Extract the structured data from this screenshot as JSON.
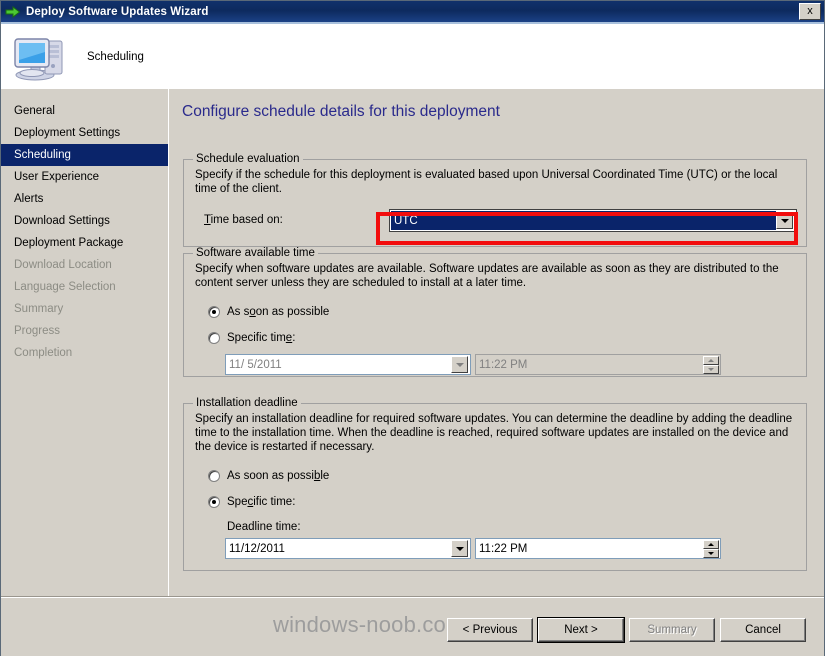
{
  "window": {
    "title": "Deploy Software Updates Wizard",
    "close_label": "x",
    "app_icon": "green-arrow-icon",
    "header_icon": "computer-monitor-icon",
    "header_label": "Scheduling"
  },
  "sidebar": {
    "items": [
      {
        "label": "General",
        "state": "enabled"
      },
      {
        "label": "Deployment Settings",
        "state": "enabled"
      },
      {
        "label": "Scheduling",
        "state": "selected"
      },
      {
        "label": "User Experience",
        "state": "enabled"
      },
      {
        "label": "Alerts",
        "state": "enabled"
      },
      {
        "label": "Download Settings",
        "state": "enabled"
      },
      {
        "label": "Deployment Package",
        "state": "enabled"
      },
      {
        "label": "Download Location",
        "state": "disabled"
      },
      {
        "label": "Language Selection",
        "state": "disabled"
      },
      {
        "label": "Summary",
        "state": "disabled"
      },
      {
        "label": "Progress",
        "state": "disabled"
      },
      {
        "label": "Completion",
        "state": "disabled"
      }
    ]
  },
  "main": {
    "page_title": "Configure schedule details for this deployment",
    "schedule_evaluation": {
      "group_title": "Schedule evaluation",
      "description": "Specify if the schedule for this deployment is evaluated based upon Universal Coordinated Time (UTC) or the local time of the client.",
      "time_based_on_label": "Time based on:",
      "time_based_on_value": "UTC",
      "highlight_color": "#f20d0d"
    },
    "software_available_time": {
      "group_title": "Software available time",
      "description": "Specify when software updates are available. Software updates are available as soon as they are distributed to the content server unless they are scheduled to install at a later time.",
      "asap_label": "As soon as possible",
      "asap_selected": true,
      "specific_label": "Specific time:",
      "specific_selected": false,
      "date_value": "11/ 5/2011",
      "time_value": "11:22 PM",
      "fields_enabled": false
    },
    "installation_deadline": {
      "group_title": "Installation deadline",
      "description": "Specify an installation deadline for required software updates. You can determine the deadline by adding the deadline time to the installation time. When the deadline is reached, required software updates are installed on the device and the device is restarted if necessary.",
      "asap_label": "As soon as possible",
      "asap_selected": false,
      "specific_label": "Specific time:",
      "specific_selected": true,
      "deadline_time_label": "Deadline time:",
      "date_value": "11/12/2011",
      "time_value": "11:22 PM",
      "fields_enabled": true
    }
  },
  "footer": {
    "previous_label": "< Previous",
    "next_label": "Next >",
    "summary_label": "Summary",
    "cancel_label": "Cancel",
    "watermark": "windows-noob.com"
  }
}
